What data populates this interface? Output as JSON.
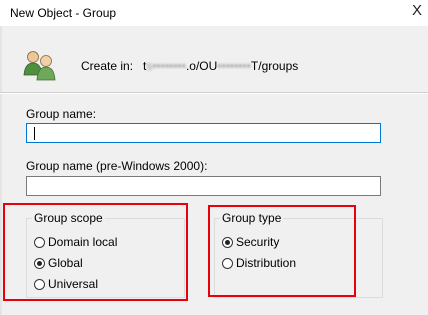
{
  "window": {
    "title": "New Object - Group",
    "close_glyph": "X"
  },
  "create_in": {
    "label": "Create in:",
    "value_prefix": "t",
    "value_blur_1": "s••••••••",
    "value_mid": ".o/OU",
    "value_blur_2": "••••••••",
    "value_suffix": "T/groups"
  },
  "fields": {
    "group_name_label": "Group name:",
    "group_name_value": "",
    "pre2000_label": "Group name (pre-Windows 2000):",
    "pre2000_value": ""
  },
  "group_scope": {
    "legend": "Group scope",
    "options": [
      {
        "label": "Domain local",
        "selected": false
      },
      {
        "label": "Global",
        "selected": true
      },
      {
        "label": "Universal",
        "selected": false
      }
    ]
  },
  "group_type": {
    "legend": "Group type",
    "options": [
      {
        "label": "Security",
        "selected": true
      },
      {
        "label": "Distribution",
        "selected": false
      }
    ]
  },
  "colors": {
    "highlight": "#e8000f",
    "background": "#f0f0f0"
  },
  "icons": {
    "header": "users-group-icon",
    "close": "close-icon"
  }
}
